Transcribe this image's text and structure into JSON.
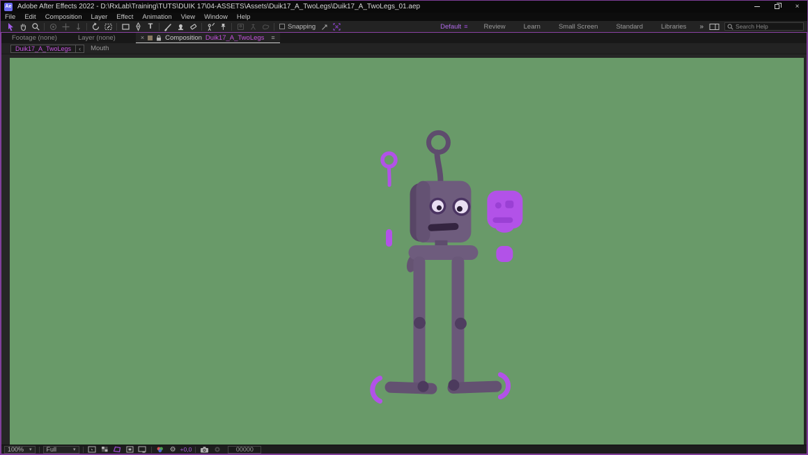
{
  "window": {
    "app_icon_label": "Ae",
    "title": "Adobe After Effects 2022 - D:\\RxLab\\Training\\TUTS\\DUIK 17\\04-ASSETS\\Assets\\Duik17_A_TwoLegs\\Duik17_A_TwoLegs_01.aep"
  },
  "menubar": {
    "items": [
      "File",
      "Edit",
      "Composition",
      "Layer",
      "Effect",
      "Animation",
      "View",
      "Window",
      "Help"
    ]
  },
  "toolbar": {
    "snapping_label": "Snapping",
    "tool_icon_names": [
      "selection",
      "hand",
      "zoom",
      "orbit-camera",
      "pan-camera",
      "dolly-camera",
      "rotation",
      "pan-behind",
      "rectangle",
      "pen",
      "type",
      "brush",
      "clone-stamp",
      "eraser",
      "roto-brush",
      "puppet-pin"
    ]
  },
  "workspaces": {
    "items": [
      "Default",
      "Review",
      "Learn",
      "Small Screen",
      "Standard",
      "Libraries"
    ],
    "active": "Default",
    "overflow_glyph": "»"
  },
  "search": {
    "placeholder": "Search Help"
  },
  "viewer_tabs": {
    "footage": "Footage (none)",
    "layer": "Layer (none)",
    "close_glyph": "×",
    "composition_label": "Composition",
    "composition_name": "Duik17_A_TwoLegs",
    "menu_glyph": "≡"
  },
  "breadcrumb": {
    "comp_name": "Duik17_A_TwoLegs",
    "separator": "‹",
    "current": "Mouth"
  },
  "statusbar": {
    "magnification": "100%",
    "resolution": "Full",
    "exposure": "+0,0",
    "frame": "00000",
    "icon_names": [
      "view-layout",
      "transparency-grid",
      "mask-visibility",
      "grid-guides",
      "toggle-viewer",
      "channels",
      "exposure-gear",
      "snapshot-camera",
      "show-snapshot"
    ]
  },
  "composition_view": {
    "background_color": "#699a69",
    "subject": "purple robot character with antenna, two legs, and detached bright-purple control shapes (ghost antenna, pills, face mask, crescent foot guides)"
  },
  "colors": {
    "accent_purple": "#b252e8",
    "highlight_magenta": "#c653e0",
    "panel_border": "#8a42a3",
    "robot_body": "#6e5c7d",
    "robot_dark": "#4b3462",
    "robot_joint": "#4f3d60",
    "mask_feature": "#9a40d4",
    "comp_background": "#699a69"
  }
}
